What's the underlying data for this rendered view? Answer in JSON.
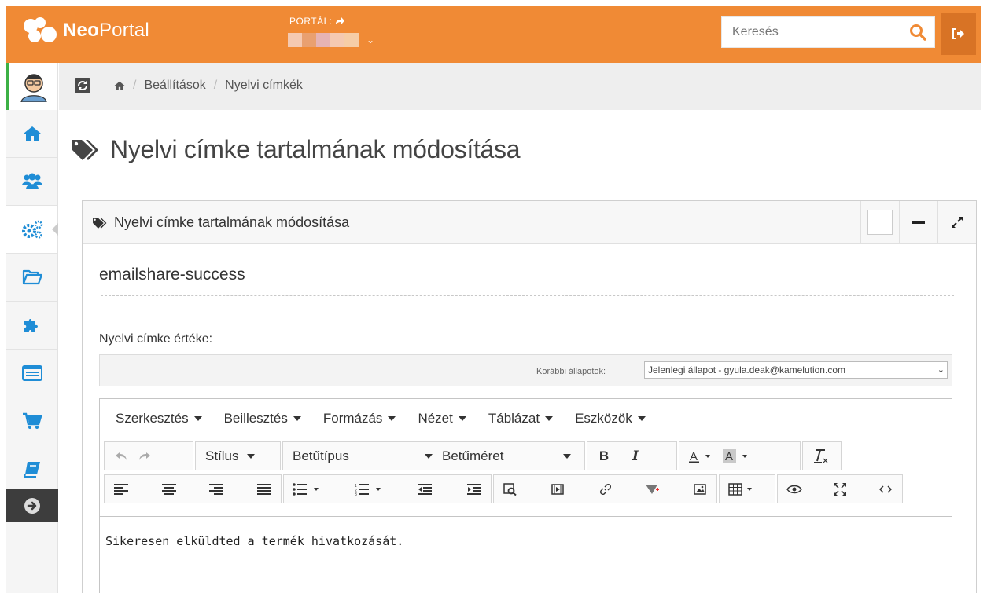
{
  "topbar": {
    "logo_bold": "Neo",
    "logo_regular": "Portal",
    "portal_label": "PORTÁL:",
    "search_placeholder": "Keresés"
  },
  "sidebar": {
    "items": [
      {
        "icon": "home-icon"
      },
      {
        "icon": "users-icon"
      },
      {
        "icon": "settings-icon",
        "active": true
      },
      {
        "icon": "folder-open-icon"
      },
      {
        "icon": "puzzle-icon"
      },
      {
        "icon": "list-card-icon"
      },
      {
        "icon": "cart-icon"
      },
      {
        "icon": "book-icon"
      }
    ]
  },
  "breadcrumb": {
    "items": [
      "Beállítások",
      "Nyelvi címkék"
    ]
  },
  "page": {
    "title": "Nyelvi címke tartalmának módosítása"
  },
  "widget": {
    "title": "Nyelvi címke tartalmának módosítása",
    "label_key": "emailshare-success",
    "field_label": "Nyelvi címke értéke:",
    "history_label": "Korábbi állapotok:",
    "history_selected": "Jelenlegi állapot - gyula.deak@kamelution.com"
  },
  "editor": {
    "menu": [
      "Szerkesztés",
      "Beillesztés",
      "Formázás",
      "Nézet",
      "Táblázat",
      "Eszközök"
    ],
    "style_label": "Stílus",
    "font_label": "Betűtípus",
    "size_label": "Betűméret",
    "bold_label": "B",
    "italic_label": "I",
    "content": "Sikeresen elküldted a termék hivatkozását."
  },
  "colors": {
    "brand_orange": "#f08a35",
    "brand_orange_dark": "#d87325",
    "sidebar_blue": "#1f8dd6"
  }
}
